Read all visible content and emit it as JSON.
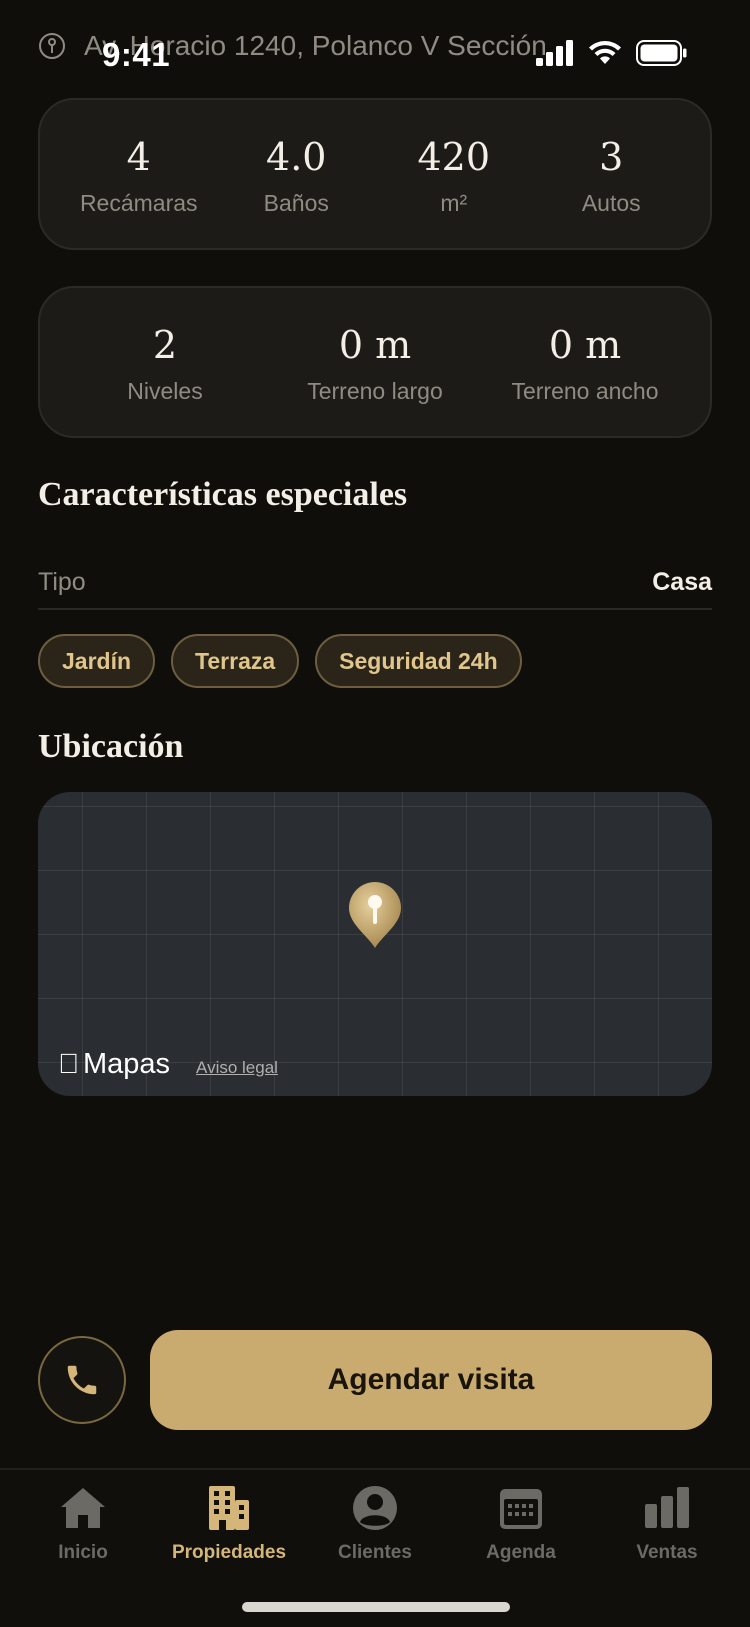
{
  "status_bar": {
    "time": "9:41"
  },
  "address": "Av. Horacio 1240, Polanco V Sección",
  "stats_primary": [
    {
      "value": "4",
      "label": "Recámaras"
    },
    {
      "value": "4.0",
      "label": "Baños"
    },
    {
      "value": "420",
      "label": "m²"
    },
    {
      "value": "3",
      "label": "Autos"
    }
  ],
  "stats_secondary": [
    {
      "value": "2",
      "label": "Niveles"
    },
    {
      "value": "0 m",
      "label": "Terreno largo"
    },
    {
      "value": "0 m",
      "label": "Terreno ancho"
    }
  ],
  "features": {
    "title": "Características especiales",
    "type_label": "Tipo",
    "type_value": "Casa",
    "chips": [
      "Jardín",
      "Terraza",
      "Seguridad 24h"
    ]
  },
  "location": {
    "title": "Ubicación",
    "map_brand": "Mapas",
    "legal_link": "Aviso legal"
  },
  "actions": {
    "schedule_label": "Agendar visita"
  },
  "tabs": [
    {
      "label": "Inicio",
      "icon": "home-icon",
      "active": false
    },
    {
      "label": "Propiedades",
      "icon": "building-icon",
      "active": true
    },
    {
      "label": "Clientes",
      "icon": "person-icon",
      "active": false
    },
    {
      "label": "Agenda",
      "icon": "calendar-icon",
      "active": false
    },
    {
      "label": "Ventas",
      "icon": "bar-chart-icon",
      "active": false
    }
  ],
  "colors": {
    "accent": "#c9ab6f",
    "background": "#0f0e0b",
    "card": "#1d1b18"
  }
}
